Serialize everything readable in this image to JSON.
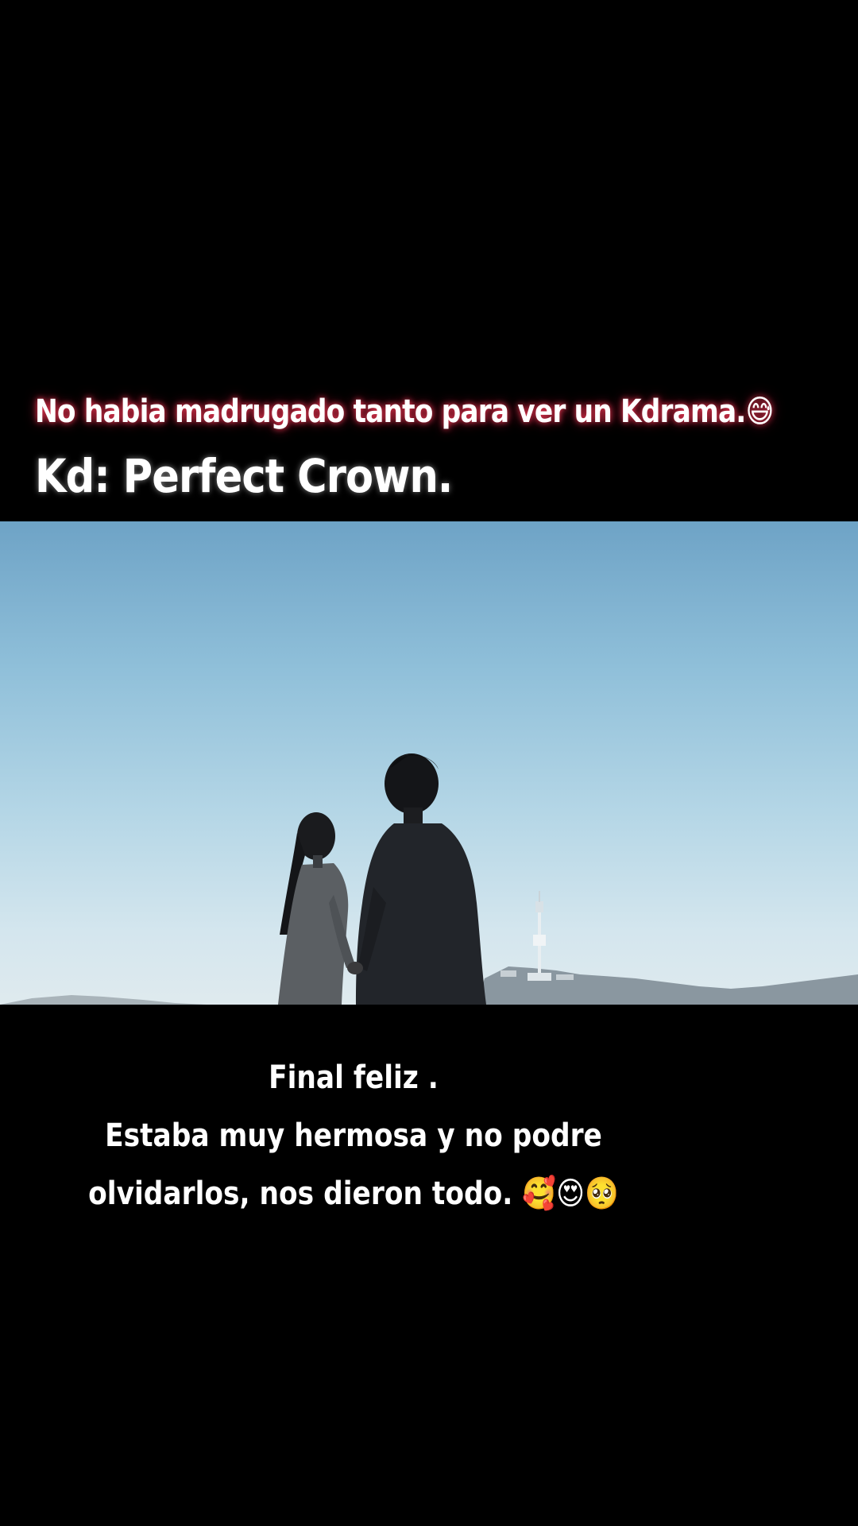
{
  "overlay": {
    "caption_top": "No habia madrugado tanto para ver un Kdrama.😅",
    "title": "Kd: Perfect Crown."
  },
  "subtitle": {
    "line1": "Final feliz .",
    "line2": "Estaba muy hermosa y no podre",
    "line3": "olvidarlos, nos dieron todo. 🥰😍🥺"
  },
  "colors": {
    "background": "#000000",
    "sky_top": "#6ea3c6",
    "sky_bottom": "#dfeaee",
    "caption_glow": "#ff3c5a"
  }
}
